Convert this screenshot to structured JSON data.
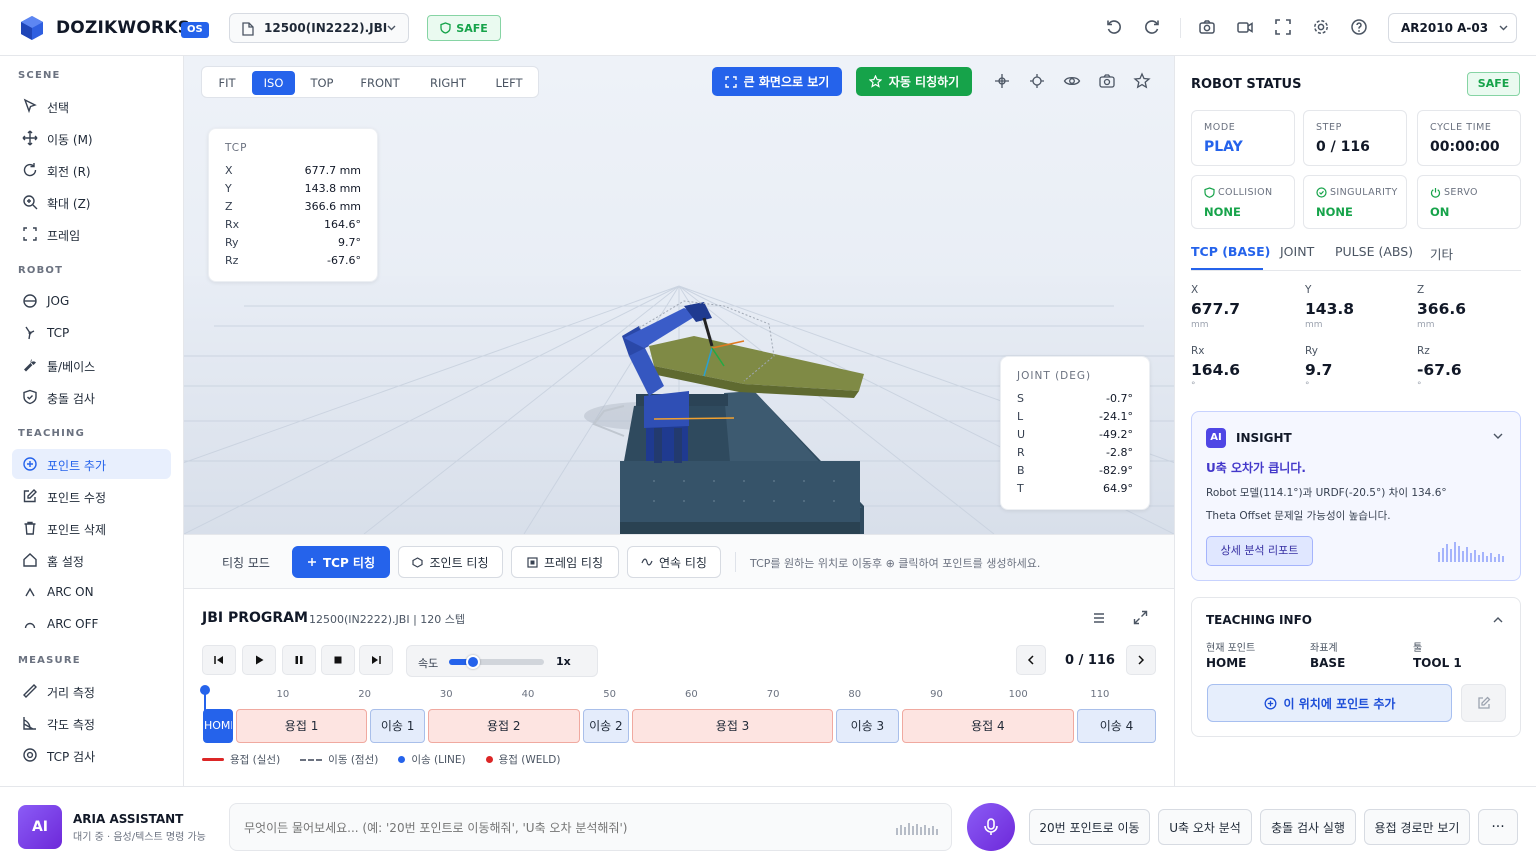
{
  "header": {
    "brand": "DOZIKWORKS",
    "os_badge": "OS",
    "file": "12500(IN2222).JBI",
    "safe": "SAFE",
    "robot": "AR2010 A-03"
  },
  "sidebar": {
    "sections": [
      {
        "title": "SCENE",
        "items": [
          "선택",
          "이동 (M)",
          "회전 (R)",
          "확대 (Z)",
          "프레임"
        ]
      },
      {
        "title": "ROBOT",
        "items": [
          "JOG",
          "TCP",
          "툴/베이스",
          "충돌 검사"
        ]
      },
      {
        "title": "TEACHING",
        "items": [
          "포인트 추가",
          "포인트 수정",
          "포인트 삭제",
          "홈 설정",
          "ARC ON",
          "ARC OFF"
        ]
      },
      {
        "title": "MEASURE",
        "items": [
          "거리 측정",
          "각도 측정",
          "TCP 검사"
        ]
      }
    ]
  },
  "viewport": {
    "tabs": [
      "FIT",
      "ISO",
      "TOP",
      "FRONT",
      "RIGHT",
      "LEFT"
    ],
    "active_tab": "ISO",
    "btn_full": "큰 화면으로 보기",
    "btn_auto": "자동 티칭하기",
    "tcp_panel": {
      "title": "TCP",
      "rows": [
        {
          "k": "X",
          "v": "677.7 mm"
        },
        {
          "k": "Y",
          "v": "143.8 mm"
        },
        {
          "k": "Z",
          "v": "366.6 mm"
        },
        {
          "k": "Rx",
          "v": "164.6°"
        },
        {
          "k": "Ry",
          "v": "9.7°"
        },
        {
          "k": "Rz",
          "v": "-67.6°"
        }
      ]
    },
    "joint_panel": {
      "title": "JOINT (DEG)",
      "rows": [
        {
          "k": "S",
          "v": "-0.7°"
        },
        {
          "k": "L",
          "v": "-24.1°"
        },
        {
          "k": "U",
          "v": "-49.2°"
        },
        {
          "k": "R",
          "v": "-2.8°"
        },
        {
          "k": "B",
          "v": "-82.9°"
        },
        {
          "k": "T",
          "v": "64.9°"
        }
      ]
    }
  },
  "teaching_bar": {
    "mode_label": "티칭 모드",
    "buttons": [
      "TCP 티칭",
      "조인트 티칭",
      "프레임 티칭",
      "연속 티칭"
    ],
    "hint": "TCP를 원하는 위치로 이동후 ⊕ 클릭하여 포인트를 생성하세요."
  },
  "program": {
    "title": "JBI PROGRAM",
    "subtitle": "12500(IN2222).JBI | 120 스텝",
    "speed_label": "속도",
    "speed_value": "1x",
    "speed_fraction": 0.25,
    "step": "0 / 116",
    "ticks": [
      "10",
      "20",
      "30",
      "40",
      "50",
      "60",
      "70",
      "80",
      "90",
      "100",
      "110"
    ],
    "segments": [
      {
        "label": "HOME",
        "kind": "home",
        "start": 0,
        "end": 4
      },
      {
        "label": "용접 1",
        "kind": "weld",
        "start": 4,
        "end": 20.5
      },
      {
        "label": "이송 1",
        "kind": "move",
        "start": 20.5,
        "end": 27.5
      },
      {
        "label": "용접 2",
        "kind": "weld",
        "start": 27.5,
        "end": 46.5
      },
      {
        "label": "이송 2",
        "kind": "move",
        "start": 46.5,
        "end": 52.5
      },
      {
        "label": "용접 3",
        "kind": "weld",
        "start": 52.5,
        "end": 77.5
      },
      {
        "label": "이송 3",
        "kind": "move",
        "start": 77.5,
        "end": 85.5
      },
      {
        "label": "용접 4",
        "kind": "weld",
        "start": 85.5,
        "end": 107
      },
      {
        "label": "이송 4",
        "kind": "move",
        "start": 107,
        "end": 117
      }
    ],
    "legend": [
      "용접 (실선)",
      "이동 (점선)",
      "이송 (LINE)",
      "용접 (WELD)"
    ]
  },
  "right": {
    "title": "ROBOT STATUS",
    "safe": "SAFE",
    "cards": [
      {
        "t": "MODE",
        "v": "PLAY"
      },
      {
        "t": "STEP",
        "v": "0 / 116"
      },
      {
        "t": "CYCLE TIME",
        "v": "00:00:00"
      }
    ],
    "checks": [
      {
        "t": "COLLISION",
        "v": "NONE"
      },
      {
        "t": "SINGULARITY",
        "v": "NONE"
      },
      {
        "t": "SERVO",
        "v": "ON"
      }
    ],
    "tabs": [
      "TCP (BASE)",
      "JOINT",
      "PULSE (ABS)",
      "기타"
    ],
    "coords": [
      {
        "l": "X",
        "n": "677.7",
        "u": "mm"
      },
      {
        "l": "Y",
        "n": "143.8",
        "u": "mm"
      },
      {
        "l": "Z",
        "n": "366.6",
        "u": "mm"
      },
      {
        "l": "Rx",
        "n": "164.6",
        "u": "°"
      },
      {
        "l": "Ry",
        "n": "9.7",
        "u": "°"
      },
      {
        "l": "Rz",
        "n": "-67.6",
        "u": "°"
      }
    ],
    "insight": {
      "badge": "AI",
      "title": "INSIGHT",
      "headline": "U축 오차가 큽니다.",
      "line1": "Robot 모델(114.1°)과 URDF(-20.5°) 차이 134.6°",
      "line2": "Theta Offset 문제일 가능성이 높습니다.",
      "button": "상세 분석 리포트"
    },
    "teaching_info": {
      "title": "TEACHING INFO",
      "cols": [
        {
          "l": "현재 포인트",
          "v": "HOME"
        },
        {
          "l": "좌표계",
          "v": "BASE"
        },
        {
          "l": "툴",
          "v": "TOOL 1"
        }
      ],
      "add_button": "이 위치에 포인트 추가"
    }
  },
  "assistant": {
    "avatar": "AI",
    "name": "ARIA ASSISTANT",
    "status": "대기 중 · 음성/텍스트 명령 가능",
    "placeholder": "무엇이든 물어보세요... (예: '20번 포인트로 이동해줘', 'U축 오차 분석해줘')",
    "chips": [
      "20번 포인트로 이동",
      "U축 오차 분석",
      "충돌 검사 실행",
      "용접 경로만 보기"
    ],
    "more": "···"
  },
  "colors": {
    "accent": "#2563eb",
    "safe": "#16a34a",
    "weld": "#dc2626",
    "robot": "#2f4fb5"
  }
}
